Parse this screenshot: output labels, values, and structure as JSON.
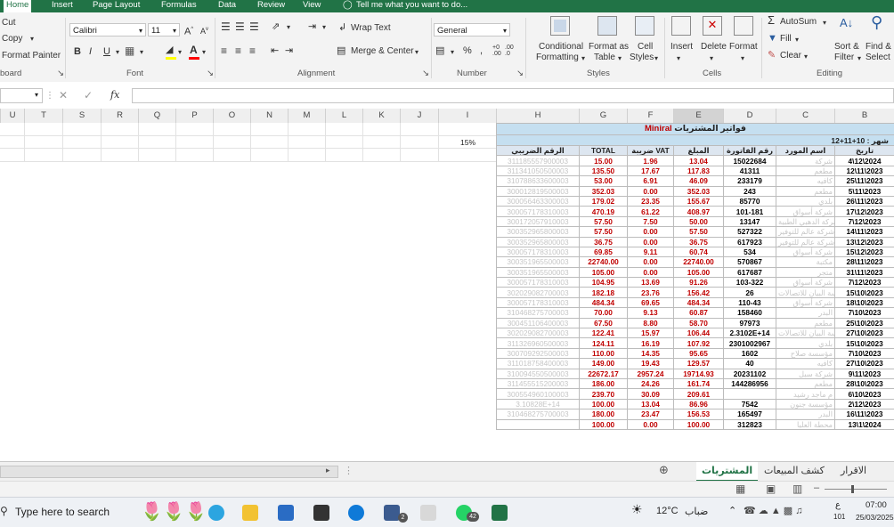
{
  "ribbon_tabs": [
    "Home",
    "Insert",
    "Page Layout",
    "Formulas",
    "Data",
    "Review",
    "View",
    "Tell me what you want to do..."
  ],
  "clipboard": {
    "cut": "Cut",
    "copy": "Copy",
    "format_painter": "Format Painter",
    "group": "board"
  },
  "font": {
    "name": "Calibri",
    "size": "11",
    "group": "Font"
  },
  "alignment": {
    "wrap": "Wrap Text",
    "merge": "Merge & Center",
    "group": "Alignment"
  },
  "number": {
    "format": "General",
    "group": "Number"
  },
  "styles": {
    "cond": "Conditional",
    "cond2": "Formatting",
    "format_as": "Format as",
    "table": "Table",
    "cell": "Cell",
    "styles_btn": "Styles",
    "group": "Styles"
  },
  "cells": {
    "insert": "Insert",
    "delete": "Delete",
    "format": "Format",
    "group": "Cells"
  },
  "editing": {
    "autosum": "AutoSum",
    "fill": "Fill",
    "clear": "Clear",
    "sort": "Sort &",
    "filter": "Filter",
    "find": "Find &",
    "select": "Select",
    "group": "Editing"
  },
  "formula_bar": {
    "fx": "fx",
    "value": ""
  },
  "columns": [
    "U",
    "T",
    "S",
    "R",
    "Q",
    "P",
    "O",
    "N",
    "M",
    "L",
    "K",
    "J",
    "I",
    "H",
    "G",
    "F",
    "E",
    "D",
    "C",
    "B"
  ],
  "sheet": {
    "title_prefix": "فواتير المشتريات",
    "title_highlight": "Miniral",
    "month_label": "شهر : 10+11+12",
    "percent": "15%",
    "headers": [
      "الرقم الضريبي",
      "TOTAL",
      "ضريبة VAT",
      "المبلغ",
      "رقم الفاتورة",
      "اسم المورد",
      "تاريخ"
    ],
    "rows": [
      [
        "311185557900003",
        "15.00",
        "1.96",
        "13.04",
        "15022684",
        "شركة",
        "4\\12\\2024"
      ],
      [
        "311341050500003",
        "135.50",
        "17.67",
        "117.83",
        "41311",
        "مطعم",
        "12\\11\\2023"
      ],
      [
        "310788633600003",
        "53.00",
        "6.91",
        "46.09",
        "233179",
        "كافيه",
        "25\\11\\2023"
      ],
      [
        "300012819500003",
        "352.03",
        "0.00",
        "352.03",
        "243",
        "مطعم",
        "5\\11\\2023"
      ],
      [
        "300056463300003",
        "179.02",
        "23.35",
        "155.67",
        "85770",
        "بلدي",
        "26\\11\\2023"
      ],
      [
        "300057178310003",
        "470.19",
        "61.22",
        "408.97",
        "101-181",
        "شركة أسواق",
        "17\\12\\2023"
      ],
      [
        "300172057910003",
        "57.50",
        "7.50",
        "50.00",
        "13147",
        "شركة الدهبي الطبية",
        "7\\12\\2023"
      ],
      [
        "300352965800003",
        "57.50",
        "0.00",
        "57.50",
        "527322",
        "شركة عالم للتوفير",
        "14\\11\\2023"
      ],
      [
        "300352965800003",
        "36.75",
        "0.00",
        "36.75",
        "617923",
        "شركة عالم للتوفير",
        "13\\12\\2023"
      ],
      [
        "300057178310003",
        "69.85",
        "9.11",
        "60.74",
        "534",
        "شركة أسواق",
        "15\\12\\2023"
      ],
      [
        "300351965500003",
        "22740.00",
        "0.00",
        "22740.00",
        "570867",
        "مكتبة",
        "28\\11\\2023"
      ],
      [
        "300351965500003",
        "105.00",
        "0.00",
        "105.00",
        "617687",
        "متجر",
        "31\\11\\2023"
      ],
      [
        "300057178310003",
        "104.95",
        "13.69",
        "91.26",
        "103-322",
        "شركة أسواق",
        "7\\12\\2023"
      ],
      [
        "302029082700003",
        "182.18",
        "23.76",
        "156.42",
        "26",
        "مؤسسة البيان للاتصالات",
        "15\\10\\2023"
      ],
      [
        "300057178310003",
        "484.34",
        "69.65",
        "484.34",
        "110-43",
        "شركة أسواق",
        "18\\10\\2023"
      ],
      [
        "310468275700003",
        "70.00",
        "9.13",
        "60.87",
        "158460",
        "البدر",
        "7\\10\\2023"
      ],
      [
        "300451106400003",
        "67.50",
        "8.80",
        "58.70",
        "97973",
        "مطعم",
        "25\\10\\2023"
      ],
      [
        "302029082700003",
        "122.41",
        "15.97",
        "106.44",
        "2.3102E+14",
        "مؤسسة البيان للاتصالات",
        "27\\10\\2023"
      ],
      [
        "311326960500003",
        "124.11",
        "16.19",
        "107.92",
        "2301002967",
        "بلدي",
        "15\\10\\2023"
      ],
      [
        "300709292500003",
        "110.00",
        "14.35",
        "95.65",
        "1602",
        "مؤسسة صلاح",
        "7\\10\\2023"
      ],
      [
        "311018758400003",
        "149.00",
        "19.43",
        "129.57",
        "40",
        "كافيه",
        "27\\10\\2023"
      ],
      [
        "310094550500003",
        "22672.17",
        "2957.24",
        "19714.93",
        "20231102",
        "شركة سبل",
        "9\\11\\2023"
      ],
      [
        "311455515200003",
        "186.00",
        "24.26",
        "161.74",
        "144286956",
        "مطعم",
        "28\\10\\2023"
      ],
      [
        "300554960100003",
        "239.70",
        "30.09",
        "209.61",
        "",
        "م ماجد رشيد",
        "6\\10\\2023"
      ],
      [
        "3.10828E+14",
        "100.00",
        "13.04",
        "86.96",
        "7542",
        "مؤسسة جنون",
        "2\\12\\2023"
      ],
      [
        "310468275700003",
        "180.00",
        "23.47",
        "156.53",
        "165497",
        "البدر",
        "16\\11\\2023"
      ],
      [
        "",
        "100.00",
        "0.00",
        "100.00",
        "312823",
        "محطة العليا",
        "13\\1\\2024"
      ]
    ]
  },
  "sheet_tabs": [
    "الاقرار",
    "كشف المبيعات",
    "المشتريات"
  ],
  "taskbar": {
    "search": "Type here to search",
    "weather_temp": "12°C",
    "weather_desc": "ضباب",
    "time": "07:00",
    "date": "25/03/2025",
    "lang": "ع",
    "badge1": "2",
    "badge2": "42",
    "notif": "101"
  },
  "accent": "#217346"
}
